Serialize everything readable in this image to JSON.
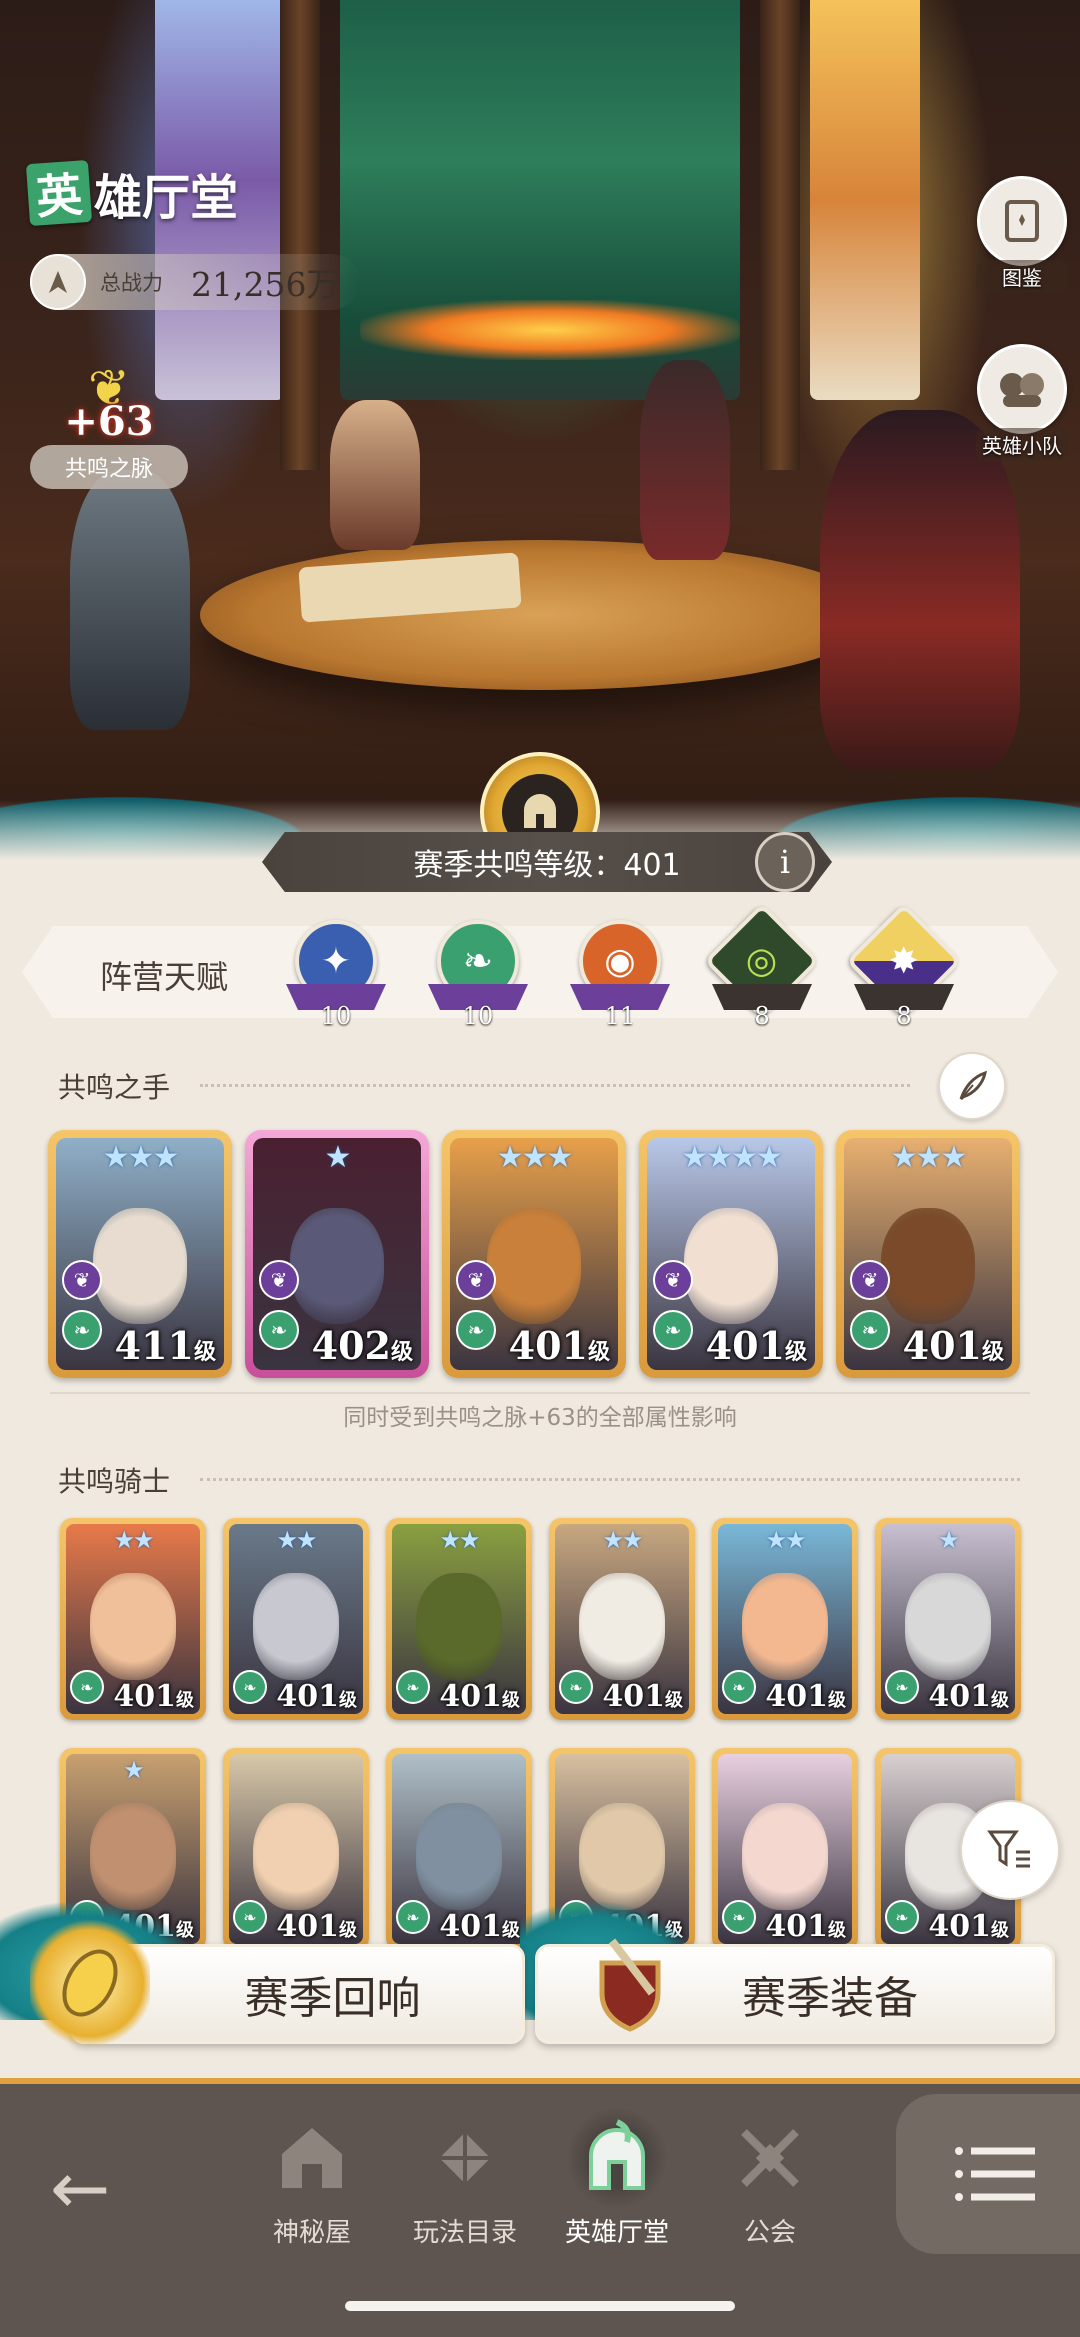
{
  "header": {
    "title_first": "英",
    "title_rest": "雄厅堂",
    "power_label": "总战力",
    "power_value": "21,256万",
    "pulse_bonus": "+63",
    "pulse_label": "共鸣之脉",
    "side_buttons": [
      {
        "label": "图鉴",
        "icon": "book-icon"
      },
      {
        "label": "英雄小队",
        "icon": "team-icon"
      }
    ]
  },
  "season": {
    "level_text": "赛季共鸣等级：401",
    "info": "i"
  },
  "faction": {
    "label": "阵营天赋",
    "medals": [
      {
        "name": "lightbearer",
        "value": "10",
        "color": "#3b5fb0"
      },
      {
        "name": "wilder",
        "value": "10",
        "color": "#3aa070"
      },
      {
        "name": "mauler",
        "value": "11",
        "color": "#d9642a"
      },
      {
        "name": "graveborn",
        "value": "8",
        "color": "#2f4a2a"
      },
      {
        "name": "celestial-hypogean",
        "value": "8",
        "color": "#4a2f8a"
      }
    ]
  },
  "hands": {
    "title": "共鸣之手",
    "note": "同时受到共鸣之脉+63的全部属性影响",
    "cards": [
      {
        "stars": "★★★",
        "level": "411",
        "unit": "级",
        "frame": "gold",
        "bg": "#8fb0c8",
        "face": "#e7dccf"
      },
      {
        "stars": "★",
        "level": "402",
        "unit": "级",
        "frame": "purple",
        "bg": "#4a2030",
        "face": "#5a5a78"
      },
      {
        "stars": "★★★",
        "level": "401",
        "unit": "级",
        "frame": "gold",
        "bg": "#e8a04a",
        "face": "#c9803a"
      },
      {
        "stars": "★★★★",
        "level": "401",
        "unit": "级",
        "frame": "gold",
        "bg": "#b8c8e8",
        "face": "#f1e0d2"
      },
      {
        "stars": "★★★",
        "level": "401",
        "unit": "级",
        "frame": "gold",
        "bg": "#e8b070",
        "face": "#7a4a2a"
      }
    ]
  },
  "knights": {
    "title": "共鸣骑士",
    "row1": [
      {
        "stars": "★★",
        "level": "401",
        "unit": "级",
        "bg": "#e87a4a",
        "face": "#f0c09a"
      },
      {
        "stars": "★★",
        "level": "401",
        "unit": "级",
        "bg": "#6a7a8a",
        "face": "#c8c8d0"
      },
      {
        "stars": "★★",
        "level": "401",
        "unit": "级",
        "bg": "#8aa040",
        "face": "#5a6a2a"
      },
      {
        "stars": "★★",
        "level": "401",
        "unit": "级",
        "bg": "#c8a880",
        "face": "#f0ece4"
      },
      {
        "stars": "★★",
        "level": "401",
        "unit": "级",
        "bg": "#7ab8d8",
        "face": "#f4b890"
      },
      {
        "stars": "★",
        "level": "401",
        "unit": "级",
        "bg": "#c8c0d0",
        "face": "#d8d8d8"
      }
    ],
    "row2": [
      {
        "stars": "★",
        "level": "401",
        "unit": "级",
        "bg": "#c8a070",
        "face": "#c09070"
      },
      {
        "stars": "",
        "level": "401",
        "unit": "级",
        "bg": "#d8c8a8",
        "face": "#f0d0b0"
      },
      {
        "stars": "",
        "level": "401",
        "unit": "级",
        "bg": "#b0c0c8",
        "face": "#8090a0"
      },
      {
        "stars": "",
        "level": "401",
        "unit": "级",
        "bg": "#d8c0a0",
        "face": "#e0c8a8"
      },
      {
        "stars": "",
        "level": "401",
        "unit": "级",
        "bg": "#e8d0e0",
        "face": "#f4d8d0"
      },
      {
        "stars": "",
        "level": "401",
        "unit": "级",
        "bg": "#d8d0d0",
        "face": "#e8e4e0"
      }
    ]
  },
  "season_buttons": {
    "echo": "赛季回响",
    "gear": "赛季装备"
  },
  "nav": {
    "back": "←",
    "items": [
      {
        "label": "神秘屋",
        "icon": "mystery-house-icon"
      },
      {
        "label": "玩法目录",
        "icon": "game-catalog-icon"
      },
      {
        "label": "英雄厅堂",
        "icon": "hero-hall-icon"
      },
      {
        "label": "公会",
        "icon": "guild-icon"
      }
    ]
  }
}
